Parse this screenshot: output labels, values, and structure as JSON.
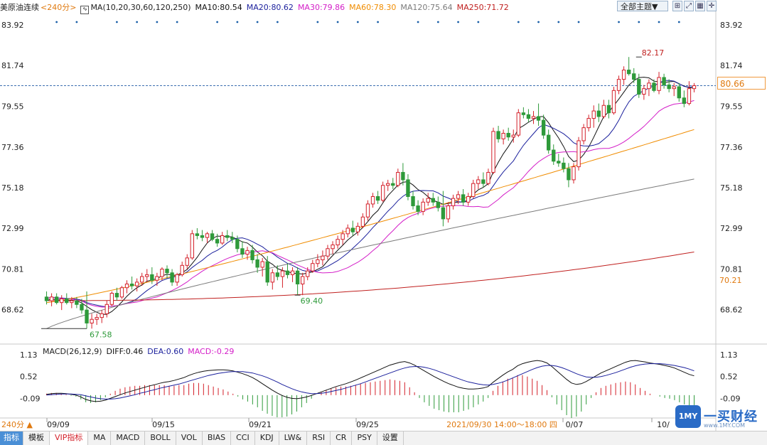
{
  "header": {
    "symbol": "美原油连续",
    "period": "<240分>",
    "ma_label": "MA(10,20,30,60,120,250)",
    "ma10": "MA10:80.54",
    "ma20": "MA20:80.62",
    "ma30": "MA30:79.86",
    "ma60": "MA60:78.30",
    "ma120": "MA120:75.64",
    "ma250": "MA250:71.72",
    "theme_button": "全部主题▼"
  },
  "colors": {
    "up": "#d4202a",
    "down": "#2e9a3a",
    "ma10": "#111111",
    "ma20": "#1a1f9c",
    "ma30": "#d41ec8",
    "ma60": "#f08c00",
    "ma120": "#7b7b7b",
    "ma250": "#c0201f",
    "text_blue": "#1a1f9c",
    "accent_orange": "#e07a10"
  },
  "price_panel": {
    "y_ticks": [
      "83.92",
      "81.74",
      "79.55",
      "77.36",
      "75.18",
      "72.99",
      "70.81",
      "68.62"
    ],
    "current_price": "80.66",
    "ma250_value": "70.21",
    "high_label": "82.17",
    "low_label_1": "67.58",
    "low_label_2": "69.40"
  },
  "macd_panel": {
    "label": "MACD(26,12,9)",
    "diff": "DIFF:0.46",
    "dea": "DEA:0.60",
    "macd": "MACD:-0.29",
    "y_ticks": [
      "1.13",
      "0.52",
      "-0.09"
    ]
  },
  "x_axis": {
    "labels": [
      "09/09",
      "09/15",
      "09/21",
      "09/25",
      "0/07",
      "10/"
    ],
    "cursor_time": "2021/09/30 14:00～18:00 四",
    "left_label": "240分 ▲"
  },
  "tabs": [
    "指标",
    "模板",
    "VIP指标",
    "MA",
    "MACD",
    "BOLL",
    "VOL",
    "BIAS",
    "CCI",
    "KDJ",
    "LW&",
    "RSI",
    "CR",
    "PSY",
    "设置"
  ],
  "watermark": {
    "logo": "1MY",
    "name": "一买财经",
    "url": "www.1MY.COM"
  },
  "chart_data": {
    "type": "candlestick",
    "ylim": [
      67.0,
      84.5
    ],
    "macd_ylim": [
      -0.6,
      1.35
    ],
    "candles": [
      {
        "o": 69.3,
        "h": 69.6,
        "l": 68.9,
        "c": 69.1
      },
      {
        "o": 69.1,
        "h": 69.5,
        "l": 68.8,
        "c": 69.3
      },
      {
        "o": 69.3,
        "h": 69.5,
        "l": 68.9,
        "c": 69.0
      },
      {
        "o": 69.0,
        "h": 69.4,
        "l": 68.6,
        "c": 69.2
      },
      {
        "o": 69.2,
        "h": 69.5,
        "l": 68.9,
        "c": 69.0
      },
      {
        "o": 69.0,
        "h": 69.3,
        "l": 68.7,
        "c": 69.1
      },
      {
        "o": 69.1,
        "h": 69.3,
        "l": 68.7,
        "c": 68.9
      },
      {
        "o": 68.9,
        "h": 69.2,
        "l": 68.4,
        "c": 68.6
      },
      {
        "o": 68.6,
        "h": 69.6,
        "l": 67.6,
        "c": 67.9
      },
      {
        "o": 67.9,
        "h": 68.4,
        "l": 67.6,
        "c": 68.1
      },
      {
        "o": 68.1,
        "h": 68.4,
        "l": 67.8,
        "c": 68.2
      },
      {
        "o": 68.2,
        "h": 68.6,
        "l": 67.9,
        "c": 68.4
      },
      {
        "o": 68.4,
        "h": 69.1,
        "l": 68.2,
        "c": 68.9
      },
      {
        "o": 68.9,
        "h": 69.6,
        "l": 68.8,
        "c": 69.5
      },
      {
        "o": 69.5,
        "h": 69.8,
        "l": 69.1,
        "c": 69.3
      },
      {
        "o": 69.3,
        "h": 69.9,
        "l": 69.2,
        "c": 69.8
      },
      {
        "o": 69.8,
        "h": 70.2,
        "l": 69.5,
        "c": 70.0
      },
      {
        "o": 70.0,
        "h": 70.4,
        "l": 69.7,
        "c": 69.9
      },
      {
        "o": 69.9,
        "h": 70.3,
        "l": 69.6,
        "c": 70.1
      },
      {
        "o": 70.1,
        "h": 70.6,
        "l": 69.9,
        "c": 70.4
      },
      {
        "o": 70.4,
        "h": 70.8,
        "l": 70.1,
        "c": 70.5
      },
      {
        "o": 70.5,
        "h": 70.9,
        "l": 70.0,
        "c": 70.2
      },
      {
        "o": 70.2,
        "h": 70.6,
        "l": 69.9,
        "c": 70.4
      },
      {
        "o": 70.4,
        "h": 70.9,
        "l": 70.2,
        "c": 70.8
      },
      {
        "o": 70.8,
        "h": 71.0,
        "l": 70.3,
        "c": 70.6
      },
      {
        "o": 70.6,
        "h": 70.8,
        "l": 69.9,
        "c": 70.1
      },
      {
        "o": 70.1,
        "h": 70.6,
        "l": 69.9,
        "c": 70.5
      },
      {
        "o": 70.5,
        "h": 71.2,
        "l": 70.4,
        "c": 71.0
      },
      {
        "o": 71.0,
        "h": 71.6,
        "l": 70.8,
        "c": 71.4
      },
      {
        "o": 71.4,
        "h": 72.9,
        "l": 71.3,
        "c": 72.7
      },
      {
        "o": 72.7,
        "h": 73.0,
        "l": 72.4,
        "c": 72.6
      },
      {
        "o": 72.6,
        "h": 72.9,
        "l": 72.3,
        "c": 72.5
      },
      {
        "o": 72.5,
        "h": 72.8,
        "l": 72.2,
        "c": 72.7
      },
      {
        "o": 72.7,
        "h": 72.9,
        "l": 72.3,
        "c": 72.4
      },
      {
        "o": 72.4,
        "h": 72.7,
        "l": 72.0,
        "c": 72.2
      },
      {
        "o": 72.2,
        "h": 72.8,
        "l": 72.1,
        "c": 72.6
      },
      {
        "o": 72.6,
        "h": 72.9,
        "l": 72.3,
        "c": 72.5
      },
      {
        "o": 72.5,
        "h": 72.8,
        "l": 72.2,
        "c": 72.4
      },
      {
        "o": 72.4,
        "h": 72.6,
        "l": 71.7,
        "c": 71.9
      },
      {
        "o": 71.9,
        "h": 72.3,
        "l": 71.4,
        "c": 71.6
      },
      {
        "o": 71.6,
        "h": 72.0,
        "l": 71.3,
        "c": 71.8
      },
      {
        "o": 71.8,
        "h": 72.1,
        "l": 71.1,
        "c": 71.3
      },
      {
        "o": 71.3,
        "h": 71.6,
        "l": 70.6,
        "c": 70.9
      },
      {
        "o": 70.9,
        "h": 71.4,
        "l": 70.4,
        "c": 71.2
      },
      {
        "o": 71.2,
        "h": 71.5,
        "l": 69.9,
        "c": 70.1
      },
      {
        "o": 70.1,
        "h": 70.8,
        "l": 69.7,
        "c": 70.6
      },
      {
        "o": 70.6,
        "h": 71.0,
        "l": 70.2,
        "c": 70.4
      },
      {
        "o": 70.4,
        "h": 70.9,
        "l": 69.8,
        "c": 70.7
      },
      {
        "o": 70.7,
        "h": 71.1,
        "l": 70.3,
        "c": 70.5
      },
      {
        "o": 70.5,
        "h": 70.9,
        "l": 70.1,
        "c": 70.7
      },
      {
        "o": 70.7,
        "h": 70.9,
        "l": 69.4,
        "c": 70.0
      },
      {
        "o": 70.0,
        "h": 70.6,
        "l": 69.4,
        "c": 70.4
      },
      {
        "o": 70.4,
        "h": 70.9,
        "l": 70.2,
        "c": 70.7
      },
      {
        "o": 70.7,
        "h": 71.3,
        "l": 70.6,
        "c": 71.1
      },
      {
        "o": 71.1,
        "h": 71.6,
        "l": 70.9,
        "c": 71.3
      },
      {
        "o": 71.3,
        "h": 71.8,
        "l": 71.0,
        "c": 71.5
      },
      {
        "o": 71.5,
        "h": 72.1,
        "l": 71.3,
        "c": 71.9
      },
      {
        "o": 71.9,
        "h": 72.3,
        "l": 71.6,
        "c": 72.1
      },
      {
        "o": 72.1,
        "h": 72.6,
        "l": 71.9,
        "c": 72.4
      },
      {
        "o": 72.4,
        "h": 72.9,
        "l": 72.1,
        "c": 72.7
      },
      {
        "o": 72.7,
        "h": 73.2,
        "l": 72.5,
        "c": 73.0
      },
      {
        "o": 73.0,
        "h": 73.4,
        "l": 72.6,
        "c": 72.8
      },
      {
        "o": 72.8,
        "h": 73.3,
        "l": 72.6,
        "c": 73.1
      },
      {
        "o": 73.1,
        "h": 73.8,
        "l": 73.0,
        "c": 73.6
      },
      {
        "o": 73.6,
        "h": 74.5,
        "l": 73.4,
        "c": 74.3
      },
      {
        "o": 74.3,
        "h": 74.9,
        "l": 74.1,
        "c": 74.7
      },
      {
        "o": 74.7,
        "h": 75.0,
        "l": 74.3,
        "c": 74.5
      },
      {
        "o": 74.5,
        "h": 75.5,
        "l": 74.4,
        "c": 75.3
      },
      {
        "o": 75.3,
        "h": 75.6,
        "l": 75.0,
        "c": 75.4
      },
      {
        "o": 75.4,
        "h": 75.7,
        "l": 75.1,
        "c": 75.3
      },
      {
        "o": 75.3,
        "h": 76.2,
        "l": 75.2,
        "c": 76.0
      },
      {
        "o": 76.0,
        "h": 76.5,
        "l": 75.3,
        "c": 75.6
      },
      {
        "o": 75.6,
        "h": 75.9,
        "l": 74.5,
        "c": 74.7
      },
      {
        "o": 74.7,
        "h": 75.0,
        "l": 74.0,
        "c": 74.2
      },
      {
        "o": 74.2,
        "h": 74.5,
        "l": 73.7,
        "c": 73.9
      },
      {
        "o": 73.9,
        "h": 74.6,
        "l": 73.7,
        "c": 74.4
      },
      {
        "o": 74.4,
        "h": 74.9,
        "l": 74.2,
        "c": 74.6
      },
      {
        "o": 74.6,
        "h": 74.9,
        "l": 74.2,
        "c": 74.4
      },
      {
        "o": 74.4,
        "h": 74.7,
        "l": 73.9,
        "c": 74.1
      },
      {
        "o": 74.1,
        "h": 75.0,
        "l": 73.1,
        "c": 73.5
      },
      {
        "o": 73.5,
        "h": 74.4,
        "l": 73.3,
        "c": 74.2
      },
      {
        "o": 74.2,
        "h": 74.8,
        "l": 74.0,
        "c": 74.6
      },
      {
        "o": 74.6,
        "h": 75.0,
        "l": 74.3,
        "c": 74.8
      },
      {
        "o": 74.8,
        "h": 75.1,
        "l": 74.2,
        "c": 74.4
      },
      {
        "o": 74.4,
        "h": 74.9,
        "l": 74.2,
        "c": 74.7
      },
      {
        "o": 74.7,
        "h": 75.6,
        "l": 74.6,
        "c": 75.4
      },
      {
        "o": 75.4,
        "h": 75.8,
        "l": 75.1,
        "c": 75.6
      },
      {
        "o": 75.6,
        "h": 76.0,
        "l": 75.2,
        "c": 75.4
      },
      {
        "o": 75.4,
        "h": 76.2,
        "l": 75.3,
        "c": 76.0
      },
      {
        "o": 76.0,
        "h": 78.4,
        "l": 75.9,
        "c": 78.2
      },
      {
        "o": 78.2,
        "h": 78.5,
        "l": 77.6,
        "c": 77.8
      },
      {
        "o": 77.8,
        "h": 78.3,
        "l": 77.5,
        "c": 78.1
      },
      {
        "o": 78.1,
        "h": 78.4,
        "l": 77.7,
        "c": 77.9
      },
      {
        "o": 77.9,
        "h": 78.3,
        "l": 77.6,
        "c": 78.0
      },
      {
        "o": 78.0,
        "h": 79.4,
        "l": 77.9,
        "c": 79.2
      },
      {
        "o": 79.2,
        "h": 79.5,
        "l": 78.9,
        "c": 79.1
      },
      {
        "o": 79.1,
        "h": 79.4,
        "l": 78.7,
        "c": 78.9
      },
      {
        "o": 78.9,
        "h": 79.3,
        "l": 78.6,
        "c": 79.0
      },
      {
        "o": 79.0,
        "h": 79.7,
        "l": 78.5,
        "c": 78.8
      },
      {
        "o": 78.8,
        "h": 79.1,
        "l": 77.8,
        "c": 78.0
      },
      {
        "o": 78.0,
        "h": 78.3,
        "l": 77.0,
        "c": 77.2
      },
      {
        "o": 77.2,
        "h": 77.5,
        "l": 76.4,
        "c": 76.6
      },
      {
        "o": 76.6,
        "h": 77.0,
        "l": 76.3,
        "c": 76.5
      },
      {
        "o": 76.5,
        "h": 76.8,
        "l": 76.0,
        "c": 76.2
      },
      {
        "o": 76.2,
        "h": 76.5,
        "l": 75.2,
        "c": 75.6
      },
      {
        "o": 75.6,
        "h": 76.5,
        "l": 75.4,
        "c": 76.3
      },
      {
        "o": 76.3,
        "h": 77.9,
        "l": 76.1,
        "c": 77.7
      },
      {
        "o": 77.7,
        "h": 78.6,
        "l": 77.5,
        "c": 78.4
      },
      {
        "o": 78.4,
        "h": 79.1,
        "l": 78.2,
        "c": 78.9
      },
      {
        "o": 78.9,
        "h": 79.6,
        "l": 78.4,
        "c": 79.3
      },
      {
        "o": 79.3,
        "h": 79.7,
        "l": 78.7,
        "c": 79.0
      },
      {
        "o": 79.0,
        "h": 79.9,
        "l": 78.9,
        "c": 79.6
      },
      {
        "o": 79.6,
        "h": 79.9,
        "l": 78.9,
        "c": 79.2
      },
      {
        "o": 79.2,
        "h": 80.6,
        "l": 79.1,
        "c": 80.4
      },
      {
        "o": 80.4,
        "h": 81.2,
        "l": 80.2,
        "c": 81.0
      },
      {
        "o": 81.0,
        "h": 81.7,
        "l": 80.7,
        "c": 81.5
      },
      {
        "o": 81.5,
        "h": 82.2,
        "l": 81.2,
        "c": 81.3
      },
      {
        "o": 81.3,
        "h": 81.6,
        "l": 80.8,
        "c": 81.0
      },
      {
        "o": 81.0,
        "h": 81.3,
        "l": 80.0,
        "c": 80.2
      },
      {
        "o": 80.2,
        "h": 80.7,
        "l": 79.9,
        "c": 80.5
      },
      {
        "o": 80.5,
        "h": 81.0,
        "l": 80.1,
        "c": 80.8
      },
      {
        "o": 80.8,
        "h": 81.0,
        "l": 80.3,
        "c": 80.4
      },
      {
        "o": 80.4,
        "h": 81.4,
        "l": 80.2,
        "c": 81.1
      },
      {
        "o": 81.1,
        "h": 81.3,
        "l": 80.5,
        "c": 80.7
      },
      {
        "o": 80.7,
        "h": 81.0,
        "l": 80.3,
        "c": 80.5
      },
      {
        "o": 80.5,
        "h": 80.8,
        "l": 80.1,
        "c": 80.6
      },
      {
        "o": 80.6,
        "h": 80.8,
        "l": 79.8,
        "c": 80.0
      },
      {
        "o": 80.0,
        "h": 80.4,
        "l": 79.5,
        "c": 79.7
      },
      {
        "o": 79.7,
        "h": 80.9,
        "l": 79.6,
        "c": 80.5
      },
      {
        "o": 80.5,
        "h": 80.8,
        "l": 80.3,
        "c": 80.66
      }
    ],
    "ma_endpoints": {
      "ma10": [
        69.1,
        80.54
      ],
      "ma20": [
        69.2,
        80.62
      ],
      "ma30": [
        69.2,
        79.86
      ],
      "ma60": [
        69.0,
        78.3
      ],
      "ma120": [
        67.6,
        75.64
      ],
      "ma250": [
        69.1,
        71.72
      ]
    },
    "macd": {
      "diff": [
        0.02,
        0.04,
        0.05,
        0.05,
        0.04,
        0.02,
        0.0,
        -0.05,
        -0.12,
        -0.16,
        -0.18,
        -0.17,
        -0.14,
        -0.09,
        -0.04,
        0.01,
        0.06,
        0.1,
        0.14,
        0.18,
        0.22,
        0.26,
        0.29,
        0.33,
        0.36,
        0.38,
        0.41,
        0.45,
        0.49,
        0.55,
        0.6,
        0.64,
        0.67,
        0.69,
        0.7,
        0.71,
        0.71,
        0.7,
        0.68,
        0.64,
        0.6,
        0.55,
        0.49,
        0.41,
        0.32,
        0.23,
        0.14,
        0.06,
        -0.01,
        -0.06,
        -0.09,
        -0.1,
        -0.08,
        -0.05,
        -0.01,
        0.04,
        0.09,
        0.14,
        0.19,
        0.24,
        0.28,
        0.32,
        0.37,
        0.42,
        0.48,
        0.54,
        0.6,
        0.66,
        0.72,
        0.78,
        0.84,
        0.88,
        0.92,
        0.94,
        0.9,
        0.84,
        0.76,
        0.68,
        0.6,
        0.52,
        0.45,
        0.38,
        0.32,
        0.27,
        0.22,
        0.19,
        0.17,
        0.17,
        0.18,
        0.2,
        0.24,
        0.36,
        0.46,
        0.56,
        0.65,
        0.72,
        0.82,
        0.88,
        0.92,
        0.95,
        0.97,
        0.95,
        0.9,
        0.8,
        0.68,
        0.56,
        0.44,
        0.34,
        0.3,
        0.32,
        0.38,
        0.46,
        0.54,
        0.62,
        0.68,
        0.74,
        0.8,
        0.86,
        0.92,
        0.96,
        0.97,
        0.95,
        0.93,
        0.9,
        0.88,
        0.86,
        0.83,
        0.8,
        0.76,
        0.7,
        0.64,
        0.58,
        0.54
      ],
      "dea": [
        0.0,
        0.01,
        0.02,
        0.03,
        0.03,
        0.03,
        0.02,
        0.01,
        -0.02,
        -0.05,
        -0.08,
        -0.1,
        -0.11,
        -0.11,
        -0.1,
        -0.08,
        -0.05,
        -0.02,
        0.01,
        0.05,
        0.08,
        0.12,
        0.15,
        0.19,
        0.22,
        0.25,
        0.28,
        0.31,
        0.35,
        0.39,
        0.43,
        0.47,
        0.51,
        0.55,
        0.58,
        0.61,
        0.63,
        0.65,
        0.66,
        0.66,
        0.66,
        0.64,
        0.62,
        0.58,
        0.54,
        0.49,
        0.43,
        0.37,
        0.3,
        0.24,
        0.18,
        0.13,
        0.09,
        0.06,
        0.04,
        0.04,
        0.05,
        0.07,
        0.1,
        0.13,
        0.16,
        0.2,
        0.24,
        0.28,
        0.32,
        0.37,
        0.42,
        0.47,
        0.52,
        0.57,
        0.62,
        0.67,
        0.72,
        0.76,
        0.79,
        0.8,
        0.8,
        0.78,
        0.75,
        0.71,
        0.66,
        0.61,
        0.56,
        0.51,
        0.46,
        0.41,
        0.37,
        0.34,
        0.31,
        0.29,
        0.28,
        0.3,
        0.33,
        0.37,
        0.42,
        0.48,
        0.54,
        0.6,
        0.66,
        0.72,
        0.77,
        0.81,
        0.83,
        0.83,
        0.81,
        0.77,
        0.72,
        0.66,
        0.6,
        0.55,
        0.51,
        0.5,
        0.5,
        0.52,
        0.55,
        0.59,
        0.63,
        0.68,
        0.73,
        0.78,
        0.82,
        0.85,
        0.87,
        0.88,
        0.88,
        0.88,
        0.87,
        0.85,
        0.83,
        0.8,
        0.77,
        0.73,
        0.68
      ]
    }
  }
}
